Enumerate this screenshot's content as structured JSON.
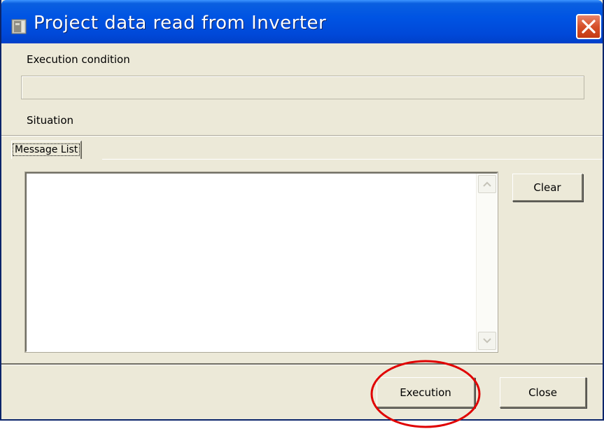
{
  "window": {
    "title": "Project data read from Inverter",
    "icon": "inverter-app-icon",
    "close_icon": "close-icon"
  },
  "execution_condition": {
    "label": "Execution condition",
    "value": ""
  },
  "situation": {
    "label": "Situation"
  },
  "tabs": [
    {
      "label": "Message List",
      "selected": true
    }
  ],
  "message_list": {
    "items": []
  },
  "buttons": {
    "clear": "Clear",
    "execution": "Execution",
    "close": "Close"
  },
  "annotation": {
    "shape": "ellipse",
    "target": "Execution",
    "color": "#e00000"
  },
  "colors": {
    "titlebar": "#0054e3",
    "dialog_bg": "#ece9d8",
    "close_button": "#d6502a"
  }
}
